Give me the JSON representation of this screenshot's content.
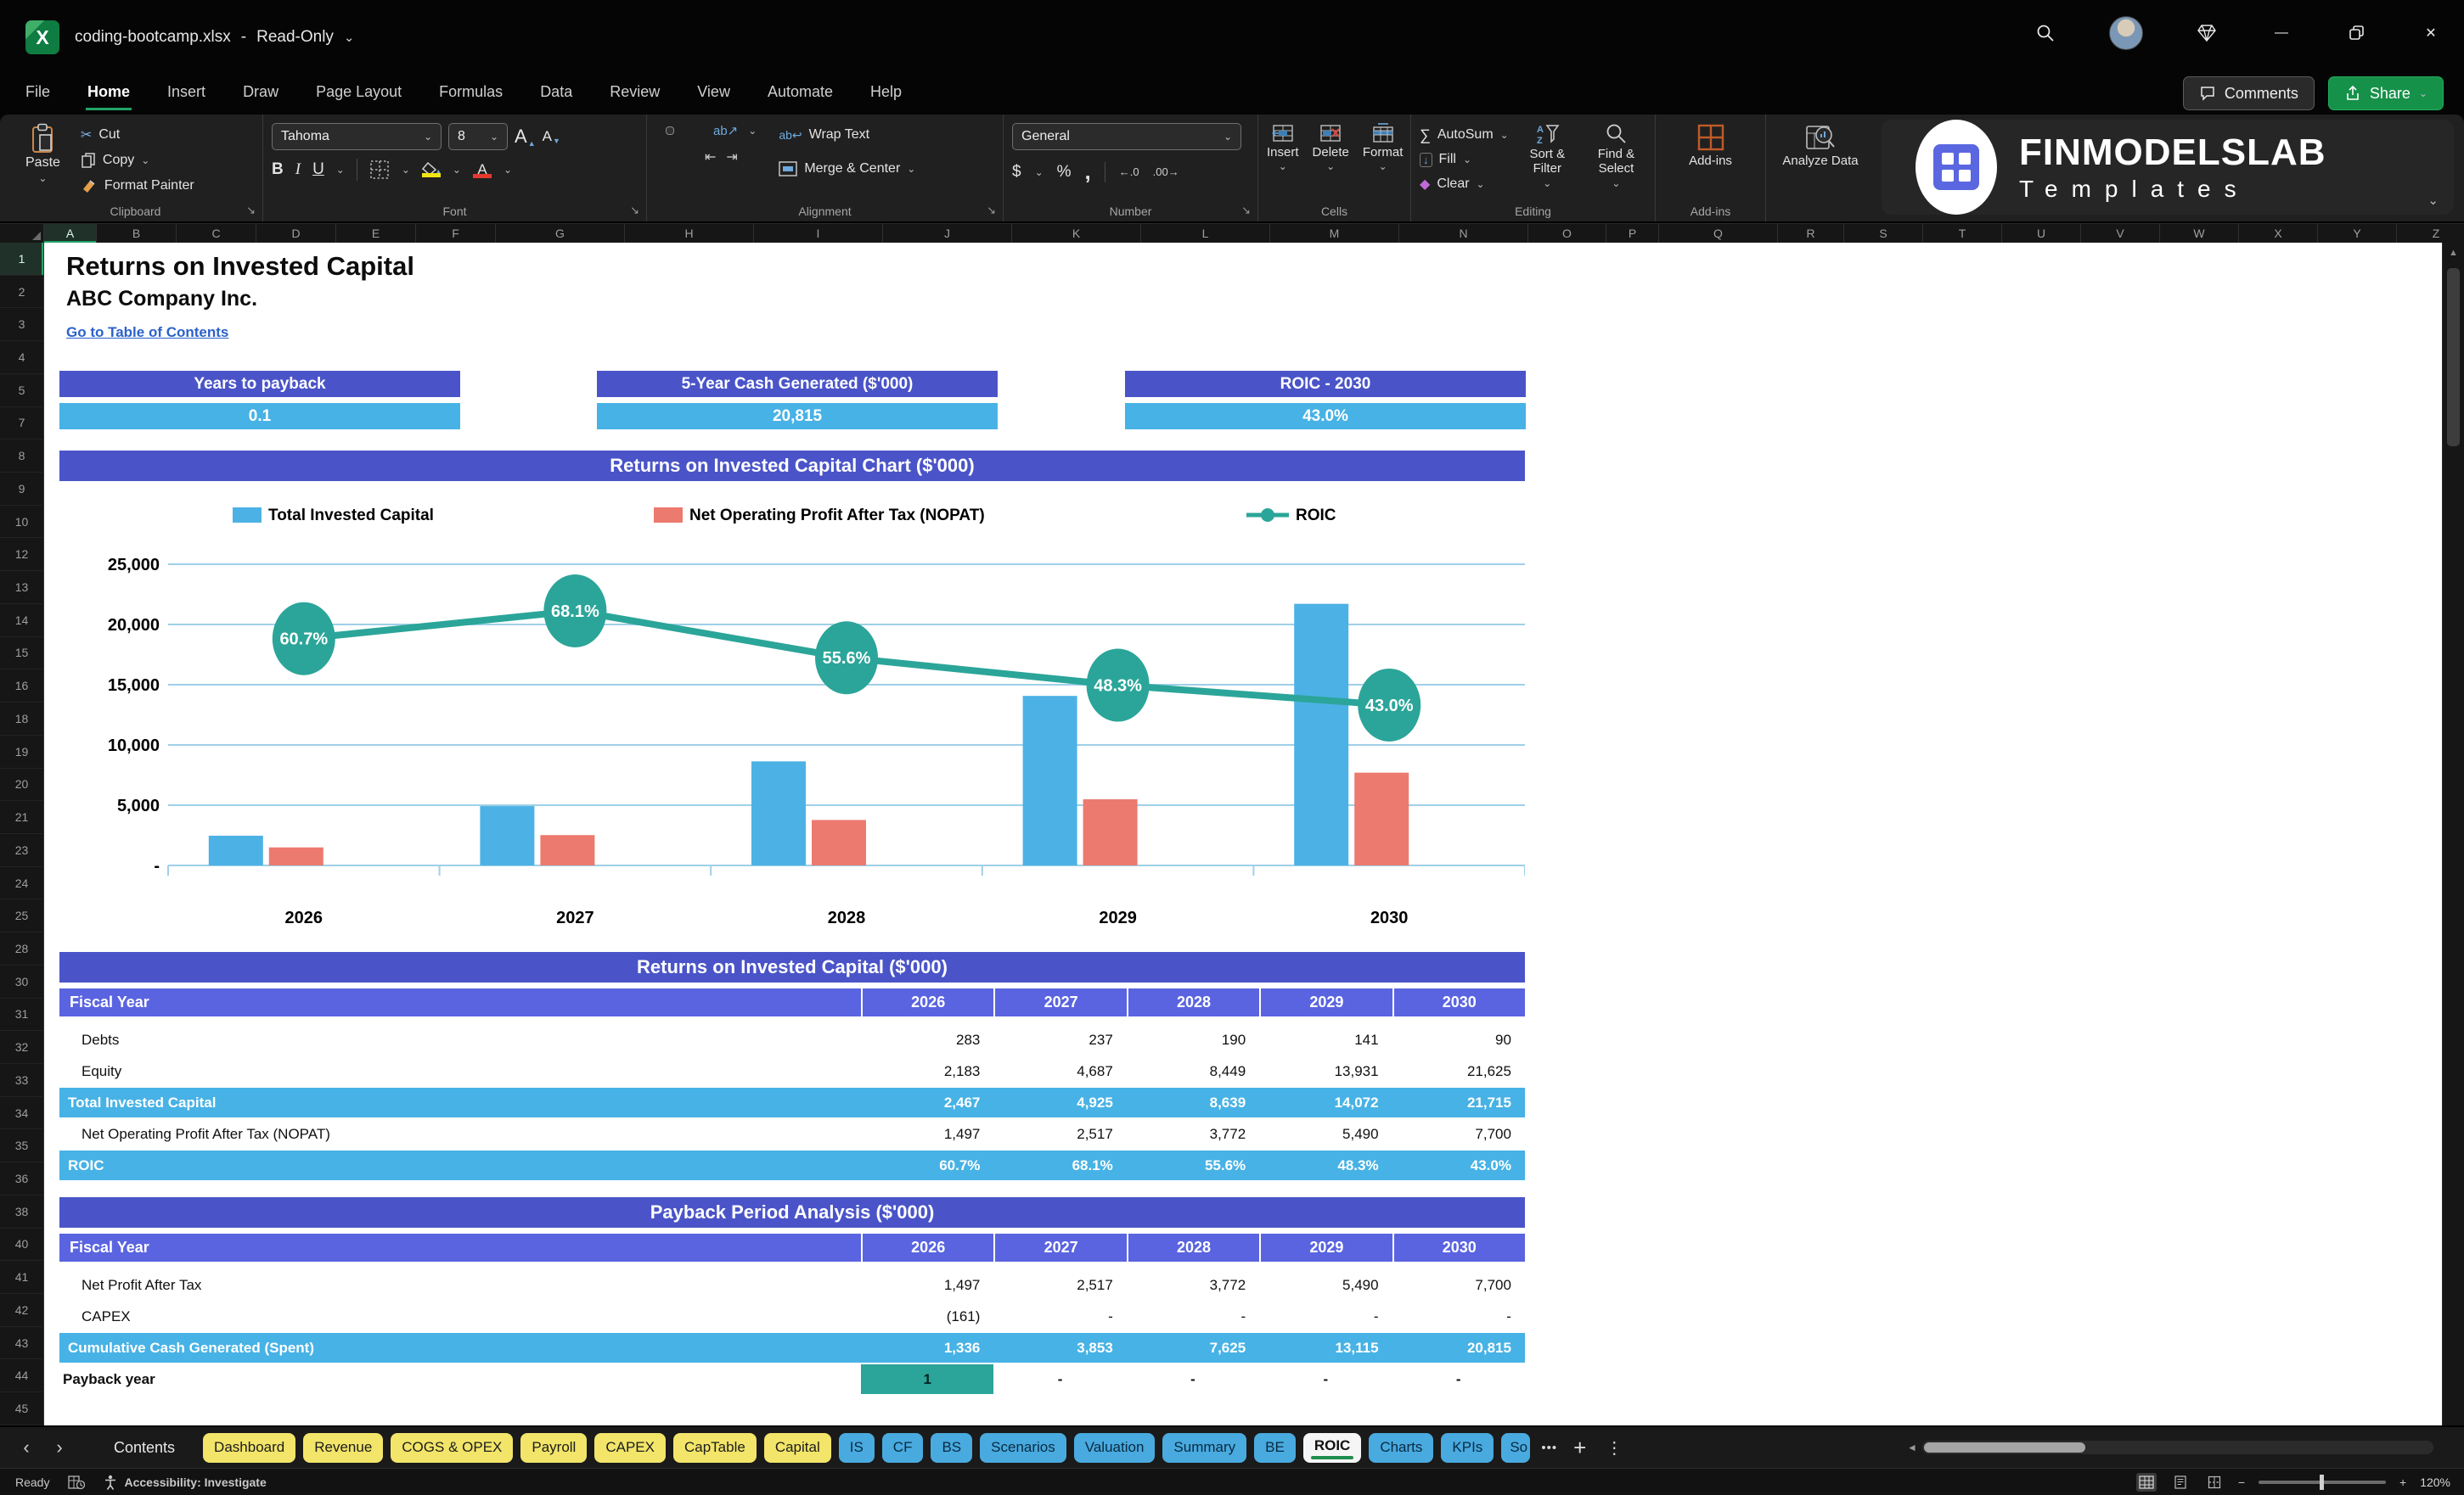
{
  "icons": {
    "chevron_down": "⌄",
    "launcher": "↘",
    "cut": "✂",
    "minimize": "—",
    "close": "✕",
    "nav_prev": "‹",
    "nav_next": "›",
    "overflow": "•••",
    "add": "+",
    "kebab": "⋮",
    "autosum": "∑",
    "fill": "↓",
    "clear": "◆",
    "dollar": "$",
    "percent": "%",
    "comma": ",",
    "dec_inc": "←.0",
    "dec_dec": ".00→",
    "bold": "B",
    "italic": "I",
    "underline": "U",
    "letterA": "A",
    "tri_up": "▲",
    "tri_down": "▼",
    "wrap": "↩",
    "merge": "⇔",
    "scroll_up": "▲",
    "scroll_left": "◄",
    "minus": "−",
    "plus": "+",
    "separator": "-"
  },
  "titlebar": {
    "filename": "coding-bootcamp.xlsx",
    "separator": "-",
    "mode": "Read-Only"
  },
  "menu": {
    "tabs": [
      "File",
      "Home",
      "Insert",
      "Draw",
      "Page Layout",
      "Formulas",
      "Data",
      "Review",
      "View",
      "Automate",
      "Help"
    ],
    "active": "Home",
    "comments_label": "Comments",
    "share_label": "Share"
  },
  "ribbon": {
    "clipboard": {
      "label": "Clipboard",
      "paste": "Paste",
      "cut": "Cut",
      "copy": "Copy",
      "format_painter": "Format Painter"
    },
    "font": {
      "label": "Font",
      "font_name": "Tahoma",
      "font_size": "8"
    },
    "alignment": {
      "label": "Alignment",
      "wrap_text": "Wrap Text",
      "merge_center": "Merge & Center"
    },
    "number": {
      "label": "Number",
      "format": "General"
    },
    "cells": {
      "label": "Cells",
      "insert": "Insert",
      "delete": "Delete",
      "format": "Format"
    },
    "editing": {
      "label": "Editing",
      "autosum": "AutoSum",
      "fill": "Fill",
      "clear": "Clear",
      "sort_filter": "Sort & Filter",
      "find_select": "Find & Select"
    },
    "addins": {
      "label": "Add-ins",
      "addins": "Add-ins",
      "analyze": "Analyze Data"
    },
    "logo": {
      "line1": "FINMODELSLAB",
      "line2": "Templates"
    }
  },
  "grid": {
    "columns": [
      "A",
      "B",
      "C",
      "D",
      "E",
      "F",
      "G",
      "H",
      "I",
      "J",
      "K",
      "L",
      "M",
      "N",
      "O",
      "P",
      "Q",
      "R",
      "S",
      "T",
      "U",
      "V",
      "W",
      "X",
      "Y",
      "Z"
    ],
    "rows": [
      "1",
      "2",
      "3",
      "4",
      "5",
      "7",
      "8",
      "9",
      "10",
      "12",
      "13",
      "14",
      "15",
      "16",
      "18",
      "19",
      "20",
      "21",
      "23",
      "24",
      "25",
      "28",
      "30",
      "31",
      "32",
      "33",
      "34",
      "35",
      "36",
      "38",
      "40",
      "41",
      "42",
      "43",
      "44",
      "45"
    ]
  },
  "doc": {
    "title": "Returns on Invested Capital",
    "company": "ABC Company Inc.",
    "link": "Go to Table of Contents"
  },
  "kpis": [
    {
      "label": "Years to payback",
      "value": "0.1"
    },
    {
      "label": "5-Year Cash Generated ($'000)",
      "value": "20,815"
    },
    {
      "label": "ROIC - 2030",
      "value": "43.0%"
    }
  ],
  "chart_data": {
    "type": "bar+line",
    "title": "Returns on Invested Capital Chart ($'000)",
    "categories": [
      "2026",
      "2027",
      "2028",
      "2029",
      "2030"
    ],
    "series": [
      {
        "name": "Total Invested Capital",
        "type": "bar",
        "color": "#4cb2e5",
        "values": [
          2467,
          4925,
          8639,
          14072,
          21715
        ]
      },
      {
        "name": "Net Operating Profit After Tax (NOPAT)",
        "type": "bar",
        "color": "#ec7a6e",
        "values": [
          1497,
          2517,
          3772,
          5490,
          7700
        ]
      },
      {
        "name": "ROIC",
        "type": "line",
        "color": "#2ba599",
        "values_pct": [
          60.7,
          68.1,
          55.6,
          48.3,
          43.0
        ],
        "labels": [
          "60.7%",
          "68.1%",
          "55.6%",
          "48.3%",
          "43.0%"
        ]
      }
    ],
    "y_axis": {
      "ticks": [
        "25,000",
        "20,000",
        "15,000",
        "10,000",
        "5,000",
        "-"
      ],
      "min": 0,
      "max": 25000,
      "grid": true,
      "grid_color": "#9fd0e8"
    },
    "legend_position": "top"
  },
  "table1": {
    "title": "Returns on Invested Capital ($'000)",
    "header": [
      "Fiscal Year",
      "2026",
      "2027",
      "2028",
      "2029",
      "2030"
    ],
    "rows": [
      {
        "label": "Debts",
        "values": [
          "283",
          "237",
          "190",
          "141",
          "90"
        ],
        "style": "plain"
      },
      {
        "label": "Equity",
        "values": [
          "2,183",
          "4,687",
          "8,449",
          "13,931",
          "21,625"
        ],
        "style": "plain"
      },
      {
        "label": "Total Invested Capital",
        "values": [
          "2,467",
          "4,925",
          "8,639",
          "14,072",
          "21,715"
        ],
        "style": "highlight"
      },
      {
        "label": "Net Operating Profit After Tax (NOPAT)",
        "values": [
          "1,497",
          "2,517",
          "3,772",
          "5,490",
          "7,700"
        ],
        "style": "plain"
      },
      {
        "label": "ROIC",
        "values": [
          "60.7%",
          "68.1%",
          "55.6%",
          "48.3%",
          "43.0%"
        ],
        "style": "highlight"
      }
    ]
  },
  "table2": {
    "title": "Payback Period Analysis ($'000)",
    "header": [
      "Fiscal Year",
      "2026",
      "2027",
      "2028",
      "2029",
      "2030"
    ],
    "rows": [
      {
        "label": "Net Profit After Tax",
        "values": [
          "1,497",
          "2,517",
          "3,772",
          "5,490",
          "7,700"
        ],
        "style": "plain"
      },
      {
        "label": "CAPEX",
        "values": [
          "(161)",
          "-",
          "-",
          "-",
          "-"
        ],
        "style": "plain"
      },
      {
        "label": "Cumulative Cash Generated (Spent)",
        "values": [
          "1,336",
          "3,853",
          "7,625",
          "13,115",
          "20,815"
        ],
        "style": "highlight"
      },
      {
        "label": "Payback year",
        "values": [
          "1",
          "-",
          "-",
          "-",
          "-"
        ],
        "style": "payback"
      }
    ]
  },
  "sheet_tabs": {
    "items": [
      {
        "label": "Contents",
        "style": "plain"
      },
      {
        "label": "Dashboard",
        "style": "yellow"
      },
      {
        "label": "Revenue",
        "style": "yellow"
      },
      {
        "label": "COGS & OPEX",
        "style": "yellow"
      },
      {
        "label": "Payroll",
        "style": "yellow"
      },
      {
        "label": "CAPEX",
        "style": "yellow"
      },
      {
        "label": "CapTable",
        "style": "yellow"
      },
      {
        "label": "Capital",
        "style": "yellow"
      },
      {
        "label": "IS",
        "style": "blue"
      },
      {
        "label": "CF",
        "style": "blue"
      },
      {
        "label": "BS",
        "style": "blue"
      },
      {
        "label": "Scenarios",
        "style": "blue"
      },
      {
        "label": "Valuation",
        "style": "blue"
      },
      {
        "label": "Summary",
        "style": "blue"
      },
      {
        "label": "BE",
        "style": "blue"
      },
      {
        "label": "ROIC",
        "style": "active"
      },
      {
        "label": "Charts",
        "style": "blue"
      },
      {
        "label": "KPIs",
        "style": "blue"
      },
      {
        "label": "So",
        "style": "blue cut"
      }
    ]
  },
  "statusbar": {
    "ready": "Ready",
    "accessibility": "Accessibility: Investigate",
    "zoom": "120%"
  },
  "colors": {
    "accent_indigo": "#4a54c8",
    "header_indigo": "#5a64e0",
    "accent_blue": "#47b2e5",
    "teal": "#2ba599",
    "bar_blue": "#4cb2e5",
    "bar_red": "#ec7a6e",
    "grid_line": "#9fd0e8",
    "tab_yellow": "#f2e569",
    "tab_blue": "#49aadf",
    "excel_green": "#21a366",
    "share_green": "#169149"
  }
}
